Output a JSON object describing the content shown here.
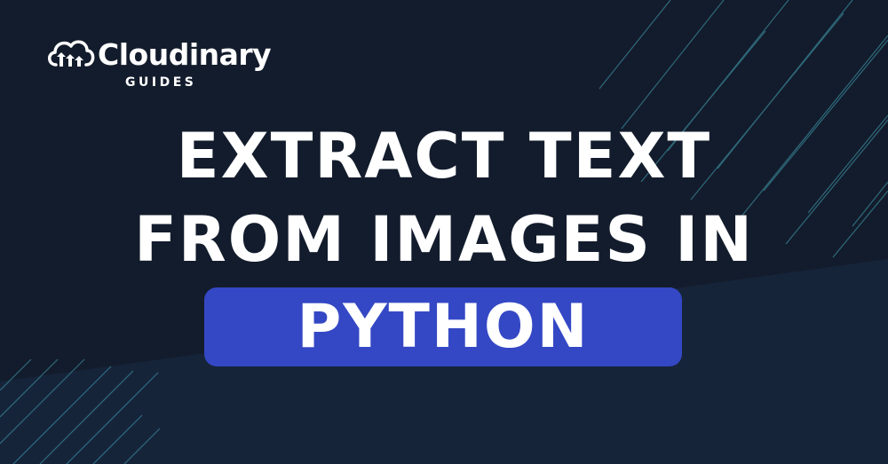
{
  "brand": {
    "name": "Cloudinary",
    "sub": "GUIDES",
    "icon": "cloud-logo-icon"
  },
  "headline": {
    "line1": "EXTRACT TEXT",
    "line2": "FROM IMAGES IN",
    "highlight": "PYTHON"
  },
  "colors": {
    "background": "#131c2c",
    "lower_band": "#16243a",
    "accent_lines": "#3a8a9c",
    "highlight_pill": "#3448c5",
    "text": "#ffffff"
  }
}
